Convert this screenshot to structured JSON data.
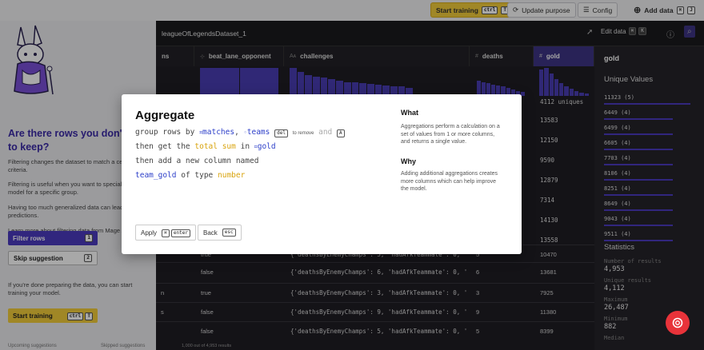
{
  "topbar": {
    "start_training": "Start training",
    "start_kbd1": "ctrl",
    "start_kbd2": "T",
    "update_purpose": "Update purpose",
    "config": "Config",
    "add_data": "Add data",
    "add_kbd1": "⌘",
    "add_kbd2": "J"
  },
  "leftpanel": {
    "heading": "Are there rows you don't want to keep?",
    "para1": "Filtering changes the dataset to match a certain criteria.",
    "para2": "Filtering is useful when you want to specialize your model for a specific group.",
    "para3": "Having too much generalized data can lead to poor predictions.",
    "para4": "Learn more about filtering data from Mage Academy.",
    "filter_rows": "Filter rows",
    "filter_kbd": "1",
    "skip_suggestion": "Skip suggestion",
    "skip_kbd": "2",
    "done_text": "If you're done preparing the data, you can start training your model.",
    "start_training": "Start training",
    "start_kbd1": "ctrl",
    "start_kbd2": "T",
    "upcoming": "Upcoming suggestions",
    "skipped": "Skipped suggestions"
  },
  "dataset": {
    "title": "leagueOfLegendsDataset_1",
    "edit_data": "Edit data",
    "edit_kbd1": "⌘",
    "edit_kbd2": "K",
    "columns": [
      {
        "type": "",
        "name": "ns"
      },
      {
        "type": "⊹",
        "name": "beat_lane_opponent"
      },
      {
        "type": "Aᴀ",
        "name": "challenges"
      },
      {
        "type": "#",
        "name": "deaths"
      },
      {
        "type": "#",
        "name": "gold"
      }
    ],
    "gold_unique_label": "4112 uniques",
    "rows": [
      {
        "c0": "",
        "c1": "true",
        "c2": "{'deathsByEnemyChamps': 5, 'hadAfkTeammate': 0, 'k…",
        "c3": "5",
        "c4": "10470"
      },
      {
        "c0": "",
        "c1": "false",
        "c2": "{'deathsByEnemyChamps': 6, 'hadAfkTeammate': 0, 'k…",
        "c3": "6",
        "c4": "13681"
      },
      {
        "c0": "n",
        "c1": "true",
        "c2": "{'deathsByEnemyChamps': 3, 'hadAfkTeammate': 0, 'k…",
        "c3": "3",
        "c4": "7925"
      },
      {
        "c0": "s",
        "c1": "false",
        "c2": "{'deathsByEnemyChamps': 9, 'hadAfkTeammate': 0, 'k…",
        "c3": "9",
        "c4": "11380"
      },
      {
        "c0": "",
        "c1": "false",
        "c2": "{'deathsByEnemyChamps': 5, 'hadAfkTeammate': 0, 'k…",
        "c3": "5",
        "c4": "8399"
      }
    ],
    "gold_hidden_values": [
      "13583",
      "12150",
      "9590",
      "12879",
      "7314",
      "14130",
      "13558"
    ],
    "footer": "1,000 out of 4,953 results"
  },
  "sidepanel": {
    "title": "gold",
    "unique_values_heading": "Unique Values",
    "unique_values": [
      {
        "label": "11323 (5)",
        "fraction": 1.0
      },
      {
        "label": "6449 (4)",
        "fraction": 0.8
      },
      {
        "label": "6499 (4)",
        "fraction": 0.8
      },
      {
        "label": "6605 (4)",
        "fraction": 0.8
      },
      {
        "label": "7703 (4)",
        "fraction": 0.8
      },
      {
        "label": "8106 (4)",
        "fraction": 0.8
      },
      {
        "label": "8251 (4)",
        "fraction": 0.8
      },
      {
        "label": "8649 (4)",
        "fraction": 0.8
      },
      {
        "label": "9043 (4)",
        "fraction": 0.8
      },
      {
        "label": "9511 (4)",
        "fraction": 0.8
      }
    ],
    "statistics_heading": "Statistics",
    "stats": [
      {
        "label": "Number of results",
        "value": "4,953"
      },
      {
        "label": "Unique results",
        "value": "4,112"
      },
      {
        "label": "Maximum",
        "value": "26,487"
      },
      {
        "label": "Minimum",
        "value": "882"
      },
      {
        "label": "Median",
        "value": ""
      }
    ]
  },
  "modal": {
    "title": "Aggregate",
    "line1_prefix": "group rows by",
    "line1_col1": "matches",
    "line1_col2": "teams",
    "line1_del": "del",
    "line1_remove": "to remove",
    "line1_and": "and",
    "line1_add_kbd": "A",
    "line2_prefix": "then get the",
    "line2_func": "total sum",
    "line2_in": "in",
    "line2_col": "gold",
    "line3": "then add a new column named",
    "line4_name": "team_gold",
    "line4_of": "of type",
    "line4_type": "number",
    "what_heading": "What",
    "what_text": "Aggregations perform a calculation on a set of values from 1 or more columns, and returns a single value.",
    "why_heading": "Why",
    "why_text": "Adding additional aggregations creates more columns which can help improve the model.",
    "apply": "Apply",
    "apply_kbd1": "⌘",
    "apply_kbd2": "enter",
    "back": "Back",
    "back_kbd": "esc"
  },
  "colors": {
    "accent_purple": "#4b3bbf",
    "accent_yellow": "#f3cd3b",
    "help_red": "#e8333a"
  }
}
